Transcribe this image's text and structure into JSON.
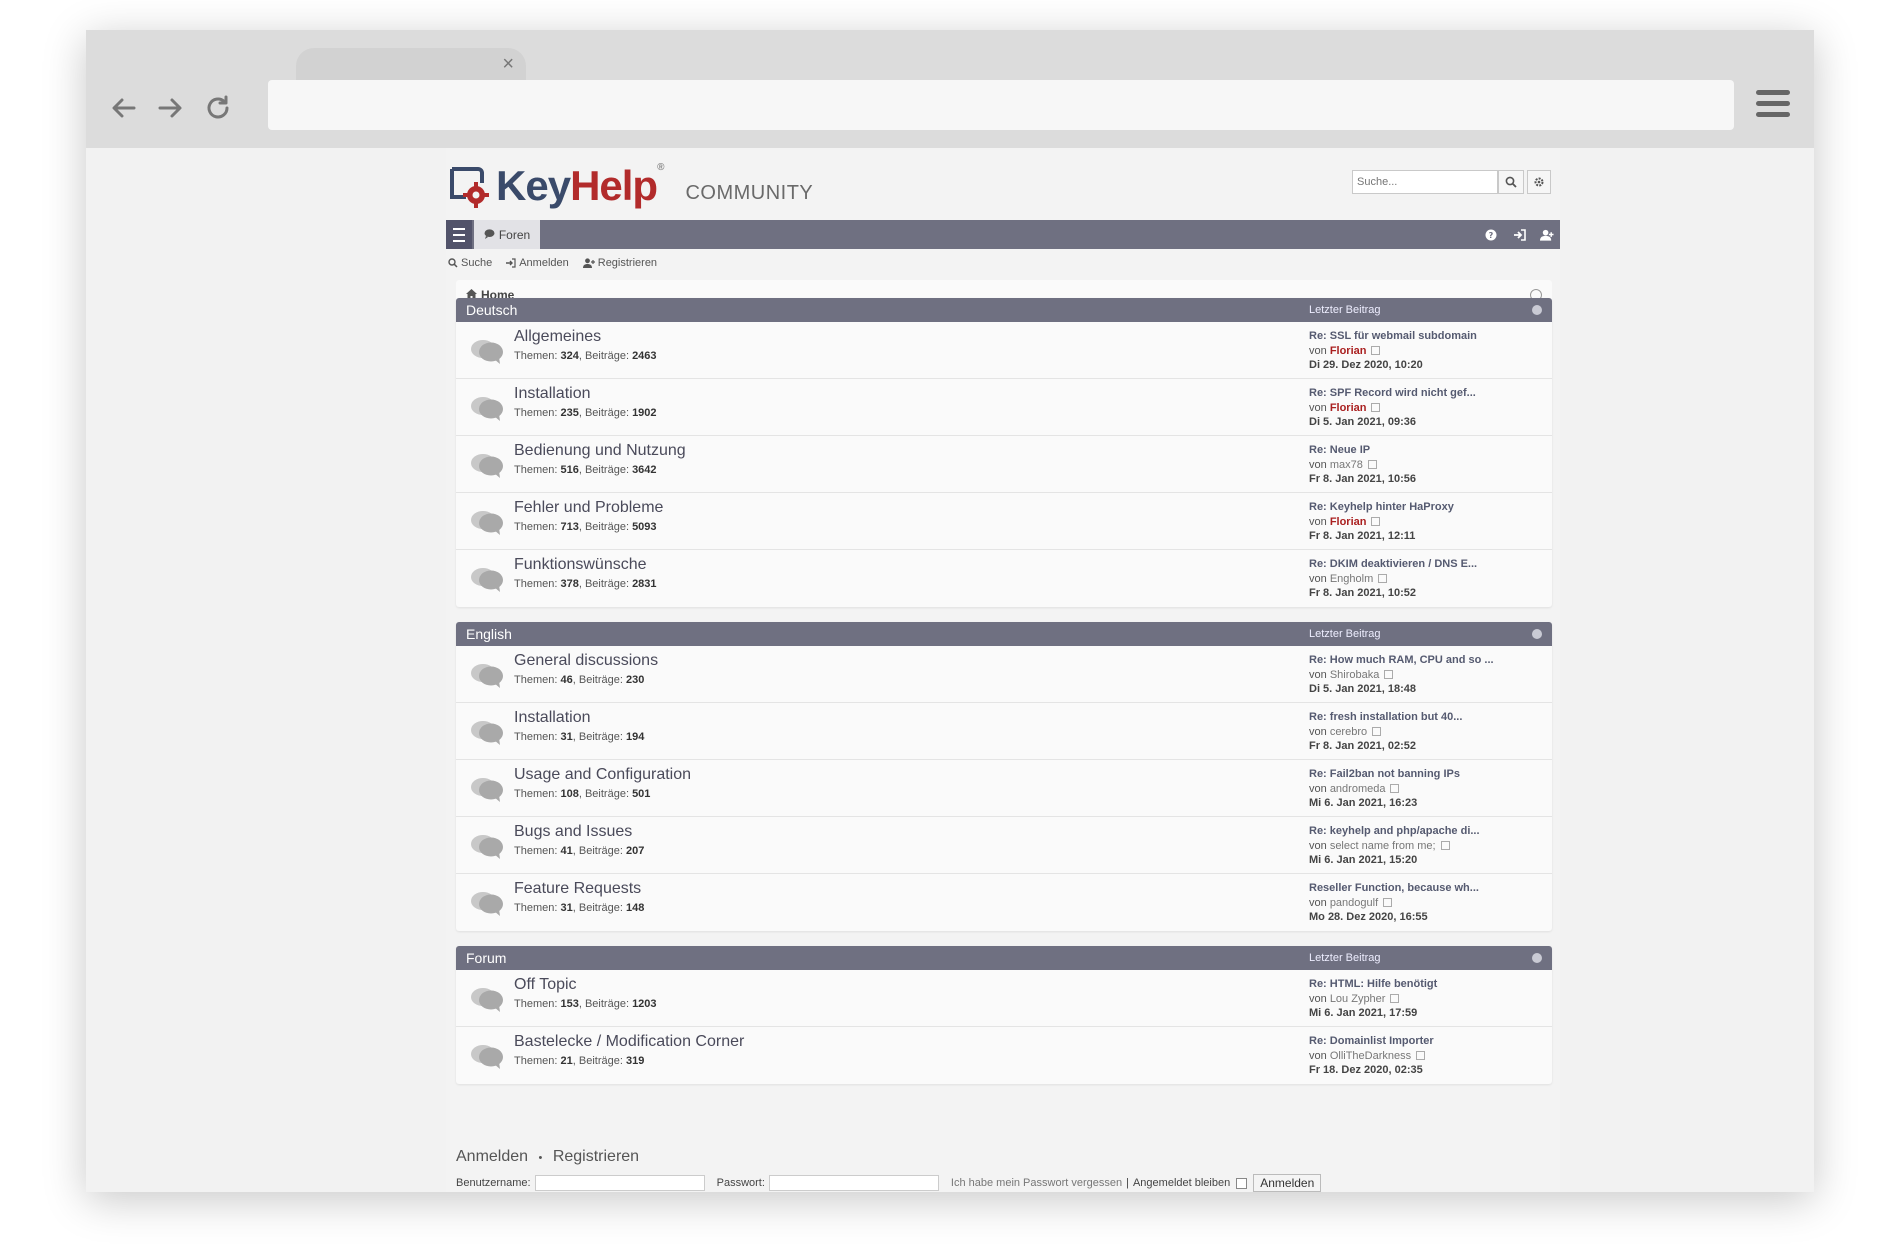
{
  "browser": {
    "tab_close": "×"
  },
  "header": {
    "logo_key": "Key",
    "logo_help": "Help",
    "logo_reg": "®",
    "community": "COMMUNITY",
    "search_placeholder": "Suche..."
  },
  "navbar": {
    "foren": "Foren"
  },
  "subnav": {
    "suche": "Suche",
    "anmelden": "Anmelden",
    "registrieren": "Registrieren"
  },
  "breadcrumb": {
    "home": "Home"
  },
  "labels": {
    "themen": "Themen:",
    "beitraege": "Beiträge:",
    "von": "von",
    "last_post": "Letzter Beitrag"
  },
  "sections": [
    {
      "title": "Deutsch",
      "forums": [
        {
          "name": "Allgemeines",
          "themen": "324",
          "beitraege": "2463",
          "lp_title": "Re: SSL für webmail subdomain",
          "lp_user": "Florian",
          "lp_user_red": true,
          "lp_date": "Di 29. Dez 2020, 10:20"
        },
        {
          "name": "Installation",
          "themen": "235",
          "beitraege": "1902",
          "lp_title": "Re: SPF Record wird nicht gef...",
          "lp_user": "Florian",
          "lp_user_red": true,
          "lp_date": "Di 5. Jan 2021, 09:36"
        },
        {
          "name": "Bedienung und Nutzung",
          "themen": "516",
          "beitraege": "3642",
          "lp_title": "Re: Neue IP",
          "lp_user": "max78",
          "lp_user_red": false,
          "lp_date": "Fr 8. Jan 2021, 10:56"
        },
        {
          "name": "Fehler und Probleme",
          "themen": "713",
          "beitraege": "5093",
          "lp_title": "Re: Keyhelp hinter HaProxy",
          "lp_user": "Florian",
          "lp_user_red": true,
          "lp_date": "Fr 8. Jan 2021, 12:11"
        },
        {
          "name": "Funktionswünsche",
          "themen": "378",
          "beitraege": "2831",
          "lp_title": "Re: DKIM deaktivieren / DNS E...",
          "lp_user": "Engholm",
          "lp_user_red": false,
          "lp_date": "Fr 8. Jan 2021, 10:52"
        }
      ]
    },
    {
      "title": "English",
      "forums": [
        {
          "name": "General discussions",
          "themen": "46",
          "beitraege": "230",
          "lp_title": "Re: How much RAM, CPU and so ...",
          "lp_user": "Shirobaka",
          "lp_user_red": false,
          "lp_date": "Di 5. Jan 2021, 18:48"
        },
        {
          "name": "Installation",
          "themen": "31",
          "beitraege": "194",
          "lp_title": "Re: fresh installation but 40...",
          "lp_user": "cerebro",
          "lp_user_red": false,
          "lp_date": "Fr 8. Jan 2021, 02:52"
        },
        {
          "name": "Usage and Configuration",
          "themen": "108",
          "beitraege": "501",
          "lp_title": "Re: Fail2ban not banning IPs",
          "lp_user": "andromeda",
          "lp_user_red": false,
          "lp_date": "Mi 6. Jan 2021, 16:23"
        },
        {
          "name": "Bugs and Issues",
          "themen": "41",
          "beitraege": "207",
          "lp_title": "Re: keyhelp and php/apache di...",
          "lp_user": "select name from me;",
          "lp_user_red": false,
          "lp_date": "Mi 6. Jan 2021, 15:20"
        },
        {
          "name": "Feature Requests",
          "themen": "31",
          "beitraege": "148",
          "lp_title": "Reseller Function, because wh...",
          "lp_user": "pandogulf",
          "lp_user_red": false,
          "lp_date": "Mo 28. Dez 2020, 16:55"
        }
      ]
    },
    {
      "title": "Forum",
      "forums": [
        {
          "name": "Off Topic",
          "themen": "153",
          "beitraege": "1203",
          "lp_title": "Re: HTML: Hilfe benötigt",
          "lp_user": "Lou Zypher",
          "lp_user_red": false,
          "lp_date": "Mi 6. Jan 2021, 17:59"
        },
        {
          "name": "Bastelecke / Modification Corner",
          "themen": "21",
          "beitraege": "319",
          "lp_title": "Re: Domainlist Importer",
          "lp_user": "OlliTheDarkness",
          "lp_user_red": false,
          "lp_date": "Fr 18. Dez 2020, 02:35"
        }
      ]
    }
  ],
  "login": {
    "title_anmelden": "Anmelden",
    "title_sep": "•",
    "title_registrieren": "Registrieren",
    "username_label": "Benutzername:",
    "password_label": "Passwort:",
    "forgot": "Ich habe mein Passwort vergessen",
    "sep": "|",
    "remember": "Angemeldet bleiben",
    "submit": "Anmelden"
  },
  "colors": {
    "navbar": "#6f7081",
    "accent_red": "#b22b2b",
    "logo_blue": "#3a4a6a"
  }
}
